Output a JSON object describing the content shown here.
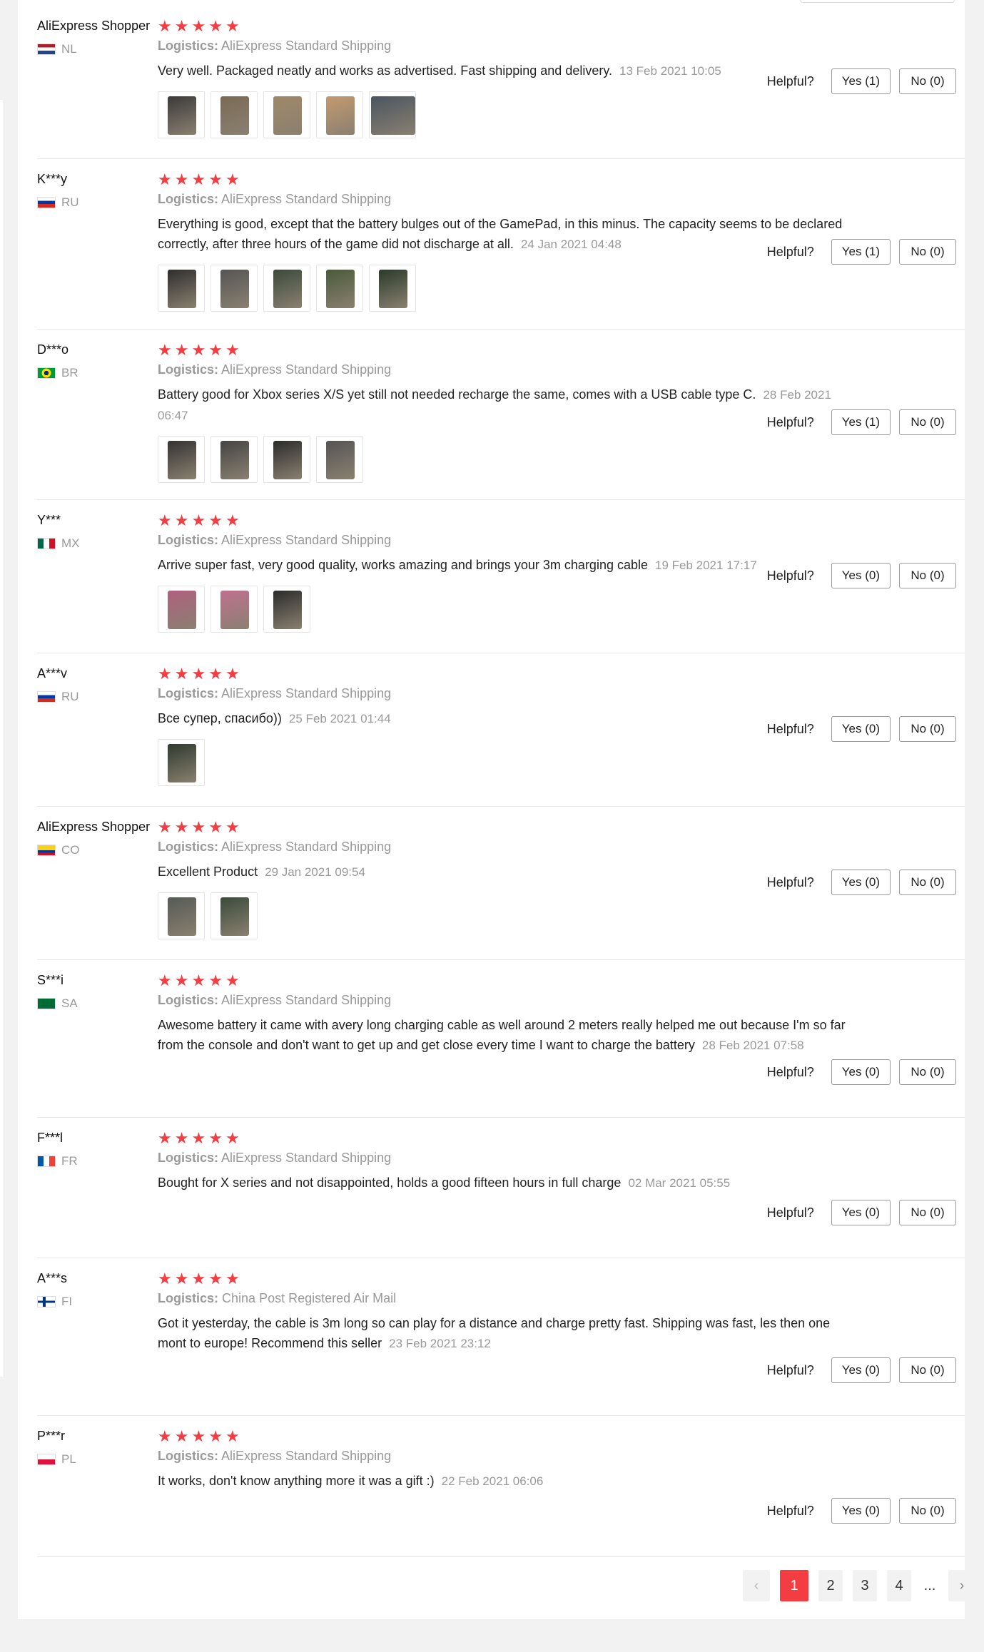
{
  "colors": {
    "accent": "#f33d42",
    "muted": "#999999",
    "border": "#e8e8e8"
  },
  "helpful_label": "Helpful?",
  "logistics_label": "Logistics:",
  "reviews": [
    {
      "user": "AliExpress Shopper",
      "country": "NL",
      "flag": [
        "#ae1c28",
        "#ffffff",
        "#21468b"
      ],
      "stars": 5,
      "logistics": "AliExpress Standard Shipping",
      "text": "Very well. Packaged neatly and works as advertised. Fast shipping and delivery.",
      "date": "13 Feb 2021 10:05",
      "images": [
        "#3a3a3a",
        "#7a6a55",
        "#a08868",
        "#c49a70",
        "#4a5560"
      ],
      "yes": "Yes (1)",
      "no": "No (0)"
    },
    {
      "user": "K***y",
      "country": "RU",
      "flag": [
        "#ffffff",
        "#0039a6",
        "#d52b1e"
      ],
      "stars": 5,
      "logistics": "AliExpress Standard Shipping",
      "text": "Everything is good, except that the battery bulges out of the GamePad, in this minus. The capacity seems to be declared correctly, after three hours of the game did not discharge at all.",
      "date": "24 Jan 2021 04:48",
      "images": [
        "#2e2e2e",
        "#555555",
        "#3b4a3b",
        "#4a5a3a",
        "#2a3a2a"
      ],
      "yes": "Yes (1)",
      "no": "No (0)"
    },
    {
      "user": "D***o",
      "country": "BR",
      "flag": [
        "#009c3b",
        "#ffdf00",
        "#002776"
      ],
      "stars": 5,
      "logistics": "AliExpress Standard Shipping",
      "text": "Battery good for Xbox series X/S yet still not needed recharge the same, comes with a USB cable type C.",
      "date": "28 Feb 2021 06:47",
      "images": [
        "#333333",
        "#444444",
        "#2b2b2b",
        "#555555"
      ],
      "yes": "Yes (1)",
      "no": "No (0)"
    },
    {
      "user": "Y***",
      "country": "MX",
      "flag": [
        "#006847",
        "#ffffff",
        "#ce1126"
      ],
      "stars": 5,
      "logistics": "AliExpress Standard Shipping",
      "text": "Arrive super fast, very good quality, works amazing and brings your 3m charging cable",
      "date": "19 Feb 2021 17:17",
      "images": [
        "#b06080",
        "#c07090",
        "#2b2b2b"
      ],
      "yes": "Yes (0)",
      "no": "No (0)"
    },
    {
      "user": "A***v",
      "country": "RU",
      "flag": [
        "#ffffff",
        "#0039a6",
        "#d52b1e"
      ],
      "stars": 5,
      "logistics": "AliExpress Standard Shipping",
      "text": "Все супер, спасибо))",
      "date": "25 Feb 2021 01:44",
      "images": [
        "#2e3a2e"
      ],
      "yes": "Yes (0)",
      "no": "No (0)"
    },
    {
      "user": "AliExpress Shopper",
      "country": "CO",
      "flag": [
        "#fcd116",
        "#003893",
        "#ce1126"
      ],
      "stars": 5,
      "logistics": "AliExpress Standard Shipping",
      "text": "Excellent Product",
      "date": "29 Jan 2021 09:54",
      "images": [
        "#555a55",
        "#3a4a3a"
      ],
      "yes": "Yes (0)",
      "no": "No (0)"
    },
    {
      "user": "S***i",
      "country": "SA",
      "flag": [
        "#006c35",
        "#006c35",
        "#006c35"
      ],
      "stars": 5,
      "logistics": "AliExpress Standard Shipping",
      "text": "Awesome battery it came with avery long charging cable as well around 2 meters really helped me out because I'm so far from the console and don't want to get up and get close every time I want to charge the battery",
      "date": "28 Feb 2021 07:58",
      "images": [],
      "yes": "Yes (0)",
      "no": "No (0)"
    },
    {
      "user": "F***l",
      "country": "FR",
      "flag": [
        "#0055a4",
        "#ffffff",
        "#ef4135"
      ],
      "stars": 5,
      "logistics": "AliExpress Standard Shipping",
      "text": "Bought for X series and not disappointed, holds a good fifteen hours in full charge",
      "date": "02 Mar 2021 05:55",
      "images": [],
      "yes": "Yes (0)",
      "no": "No (0)"
    },
    {
      "user": "A***s",
      "country": "FI",
      "flag": [
        "#ffffff",
        "#003580",
        "#ffffff"
      ],
      "stars": 5,
      "logistics": "China Post Registered Air Mail",
      "text": "Got it yesterday, the cable is 3m long so can play for a distance and charge pretty fast. Shipping was fast, les then one mont to europe! Recommend this seller",
      "date": "23 Feb 2021 23:12",
      "images": [],
      "yes": "Yes (0)",
      "no": "No (0)"
    },
    {
      "user": "P***r",
      "country": "PL",
      "flag": [
        "#ffffff",
        "#ffffff",
        "#dc143c"
      ],
      "stars": 5,
      "logistics": "AliExpress Standard Shipping",
      "text": "It works, don't know anything more it was a gift :)",
      "date": "22 Feb 2021 06:06",
      "images": [],
      "yes": "Yes (0)",
      "no": "No (0)"
    }
  ],
  "pagination": {
    "prev": "‹",
    "pages": [
      "1",
      "2",
      "3",
      "4"
    ],
    "active": "1",
    "ellipsis": "...",
    "next": "›"
  }
}
